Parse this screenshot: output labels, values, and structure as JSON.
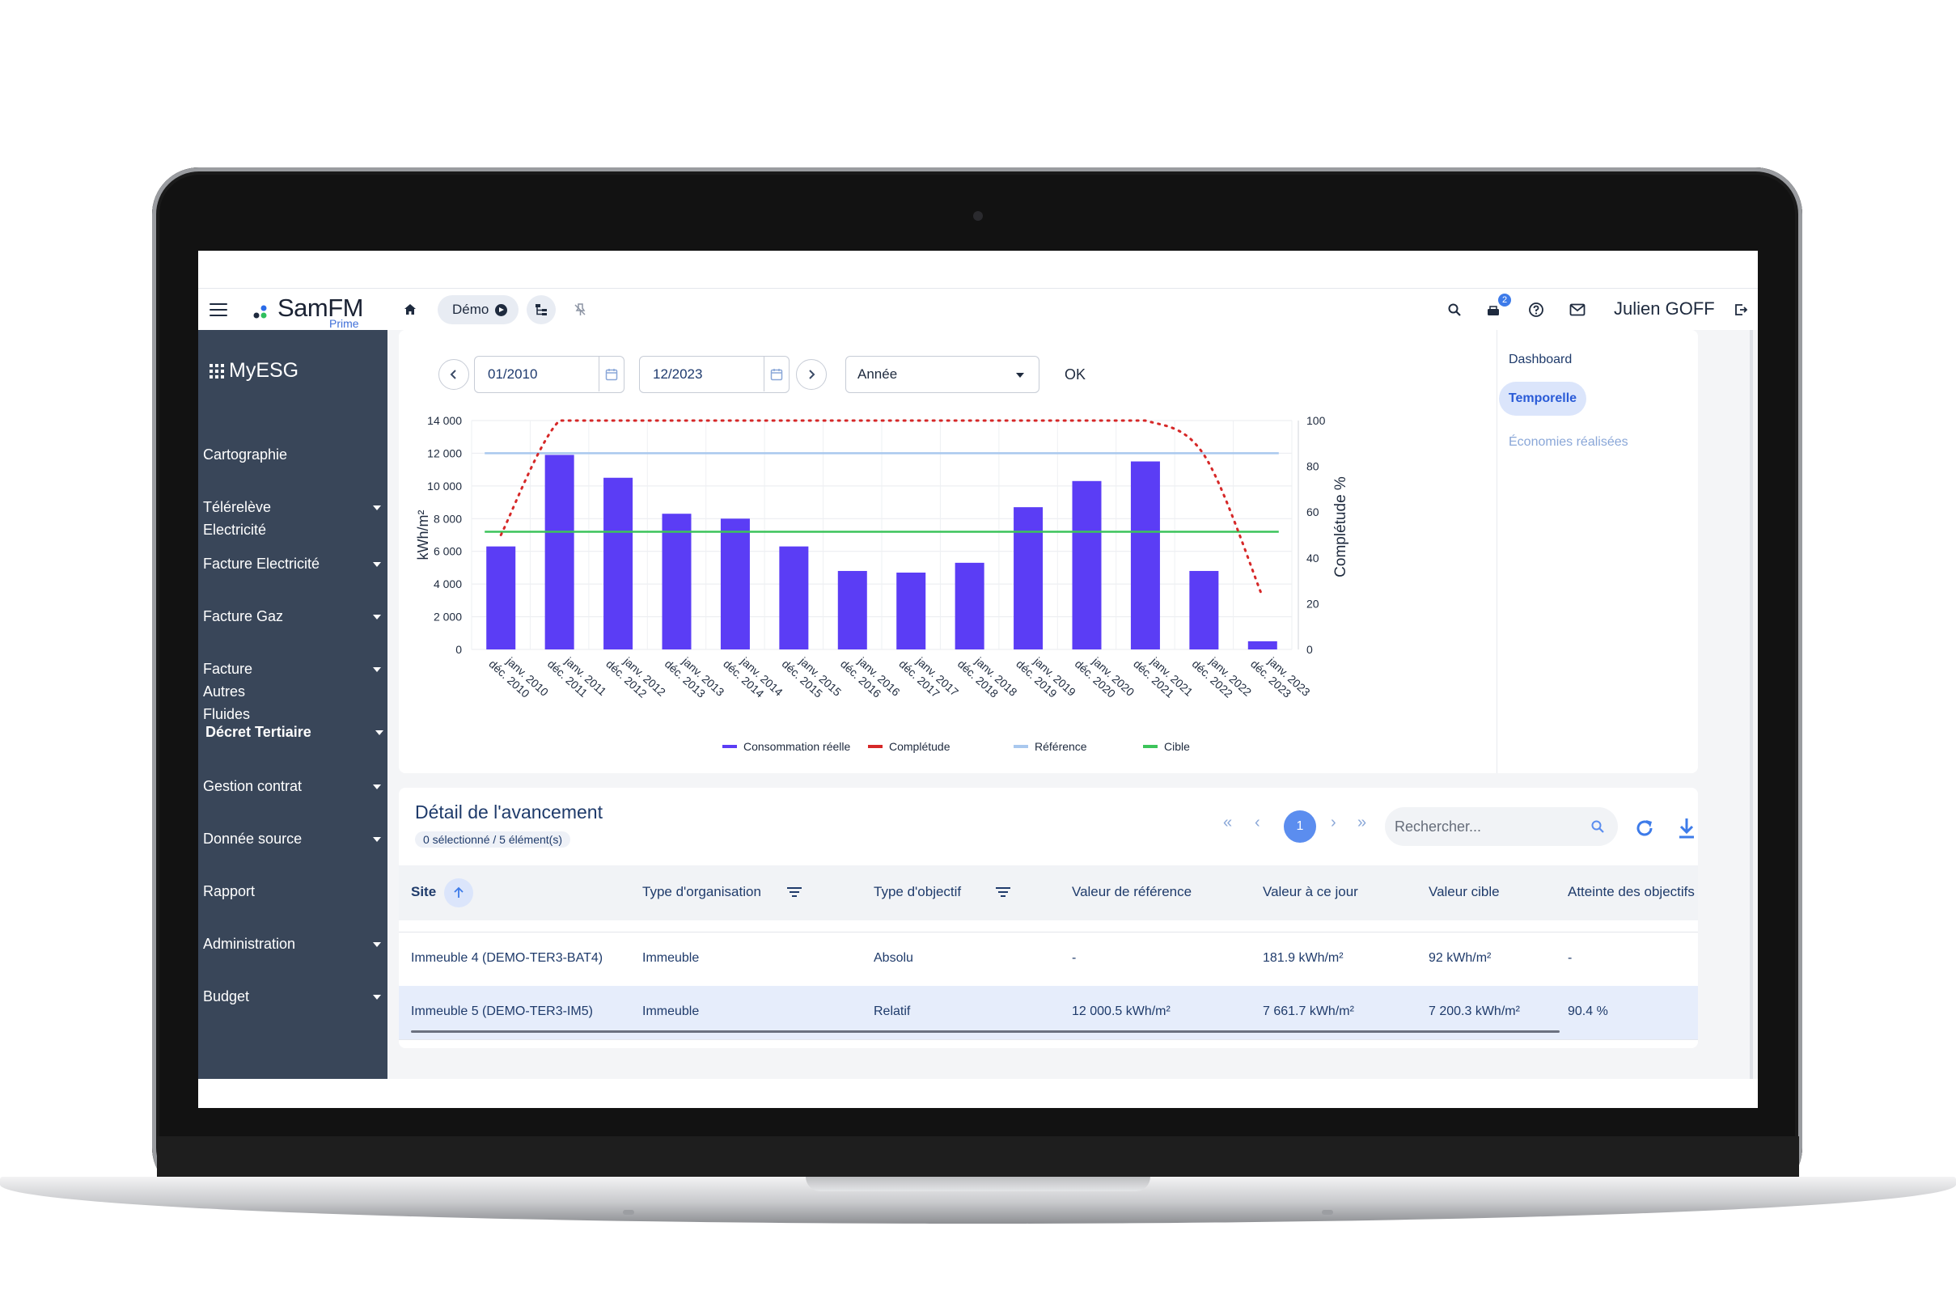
{
  "topbar": {
    "logo_text": "SamFM",
    "logo_sub": "Prime",
    "demo_label": "Démo",
    "notification_count": "2",
    "user_name": "Julien GOFF"
  },
  "sidebar": {
    "brand": "MyESG",
    "items": [
      {
        "label": "Cartographie",
        "caret": false,
        "bold": false
      },
      {
        "label": "Télérelève Electricité",
        "caret": true,
        "bold": false
      },
      {
        "label": "Facture Electricité",
        "caret": true,
        "bold": false
      },
      {
        "label": "Facture Gaz",
        "caret": true,
        "bold": false
      },
      {
        "label": "Facture Autres Fluides",
        "caret": true,
        "bold": false
      },
      {
        "label": "Décret Tertiaire",
        "caret": true,
        "bold": true
      },
      {
        "label": "Gestion contrat",
        "caret": true,
        "bold": false
      },
      {
        "label": "Donnée source",
        "caret": true,
        "bold": false
      },
      {
        "label": "Rapport",
        "caret": false,
        "bold": false
      },
      {
        "label": "Administration",
        "caret": true,
        "bold": false
      },
      {
        "label": "Budget",
        "caret": true,
        "bold": false
      }
    ]
  },
  "filters": {
    "start_date": "01/2010",
    "end_date": "12/2023",
    "period": "Année",
    "ok_label": "OK"
  },
  "right_nav": {
    "dashboard": "Dashboard",
    "temporelle": "Temporelle",
    "economies": "Économies réalisées"
  },
  "chart_data": {
    "type": "bar",
    "categories": [
      "janv. 2010 déc. 2010",
      "janv. 2011 déc. 2011",
      "janv. 2012 déc. 2012",
      "janv. 2013 déc. 2013",
      "janv. 2014 déc. 2014",
      "janv. 2015 déc. 2015",
      "janv. 2016 déc. 2016",
      "janv. 2017 déc. 2017",
      "janv. 2018 déc. 2018",
      "janv. 2019 déc. 2019",
      "janv. 2020 déc. 2020",
      "janv. 2021 déc. 2021",
      "janv. 2022 déc. 2022",
      "janv. 2023 déc. 2023"
    ],
    "category_lines": [
      [
        "janv. 2010",
        "déc. 2010"
      ],
      [
        "janv. 2011",
        "déc. 2011"
      ],
      [
        "janv. 2012",
        "déc. 2012"
      ],
      [
        "janv. 2013",
        "déc. 2013"
      ],
      [
        "janv. 2014",
        "déc. 2014"
      ],
      [
        "janv. 2015",
        "déc. 2015"
      ],
      [
        "janv. 2016",
        "déc. 2016"
      ],
      [
        "janv. 2017",
        "déc. 2017"
      ],
      [
        "janv. 2018",
        "déc. 2018"
      ],
      [
        "janv. 2019",
        "déc. 2019"
      ],
      [
        "janv. 2020",
        "déc. 2020"
      ],
      [
        "janv. 2021",
        "déc. 2021"
      ],
      [
        "janv. 2022",
        "déc. 2022"
      ],
      [
        "janv. 2023",
        "déc. 2023"
      ]
    ],
    "series": [
      {
        "name": "Consommation réelle",
        "color": "#5b3df5",
        "values": [
          6300,
          11900,
          10500,
          8300,
          8000,
          6300,
          4800,
          4700,
          5300,
          8700,
          10300,
          11500,
          4800,
          500
        ]
      },
      {
        "name": "Complétude",
        "color": "#d62828",
        "values": [
          50,
          100,
          100,
          100,
          100,
          100,
          100,
          100,
          100,
          100,
          100,
          100,
          85,
          23
        ]
      },
      {
        "name": "Référence",
        "color": "#a9c8ee",
        "value": 12000
      },
      {
        "name": "Cible",
        "color": "#3cc45a",
        "value": 7200
      }
    ],
    "ylabel": "kWh/m²",
    "y2label": "Complétude %",
    "ylim": [
      0,
      14000
    ],
    "y2lim": [
      0,
      100
    ],
    "yticks": [
      "0",
      "2 000",
      "4 000",
      "6 000",
      "8 000",
      "10 000",
      "12 000",
      "14 000"
    ],
    "y2ticks": [
      "0",
      "20",
      "40",
      "60",
      "80",
      "100"
    ],
    "grid": true,
    "legend": "bottom"
  },
  "table": {
    "title": "Détail de l'avancement",
    "selection": "0 sélectionné / 5 élément(s)",
    "current_page": "1",
    "search_placeholder": "Rechercher...",
    "headers": [
      "Site",
      "Type d'organisation",
      "Type d'objectif",
      "Valeur de référence",
      "Valeur à ce jour",
      "Valeur cible",
      "Atteinte des objectifs"
    ],
    "rows": [
      [
        "Immeuble 4 (DEMO-TER3-BAT4)",
        "Immeuble",
        "Absolu",
        "-",
        "181.9 kWh/m²",
        "92 kWh/m²",
        "-"
      ],
      [
        "Immeuble 5 (DEMO-TER3-IM5)",
        "Immeuble",
        "Relatif",
        "12 000.5 kWh/m²",
        "7 661.7 kWh/m²",
        "7 200.3 kWh/m²",
        "90.4 %"
      ]
    ]
  }
}
